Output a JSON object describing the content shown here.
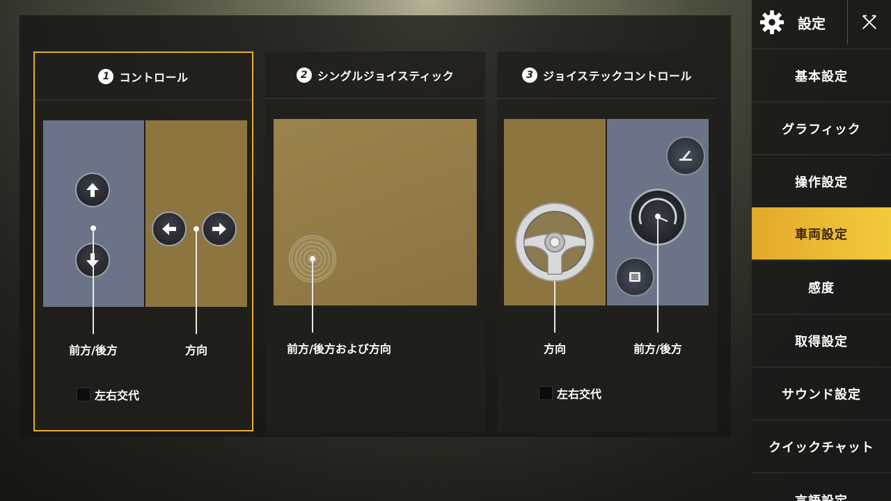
{
  "colors": {
    "accent": "#e8ae2c",
    "active_tab": "#f3ca3c",
    "blue_zone": "#6a7388",
    "gold_zone": "#8d7540"
  },
  "cards": [
    {
      "number": "1",
      "title": "コントロール",
      "selected": true,
      "labels": {
        "left": "前方/後方",
        "right": "方向"
      },
      "checkbox": {
        "label": "左右交代",
        "checked": false
      }
    },
    {
      "number": "2",
      "title": "シングルジョイスティック",
      "selected": false,
      "labels": {
        "center": "前方/後方および方向"
      }
    },
    {
      "number": "3",
      "title": "ジョイステックコントロール",
      "selected": false,
      "labels": {
        "left": "方向",
        "right": "前方/後方"
      },
      "checkbox": {
        "label": "左右交代",
        "checked": false
      }
    }
  ],
  "sidebar": {
    "settings_label": "設定",
    "settings_icon": "gear-icon",
    "close_icon": "close-icon",
    "items": [
      {
        "label": "基本設定",
        "active": false
      },
      {
        "label": "グラフィック",
        "active": false
      },
      {
        "label": "操作設定",
        "active": false
      },
      {
        "label": "車両設定",
        "active": true
      },
      {
        "label": "感度",
        "active": false
      },
      {
        "label": "取得設定",
        "active": false
      },
      {
        "label": "サウンド設定",
        "active": false
      },
      {
        "label": "クイックチャット",
        "active": false
      },
      {
        "label": "言語設定",
        "active": false
      }
    ]
  }
}
